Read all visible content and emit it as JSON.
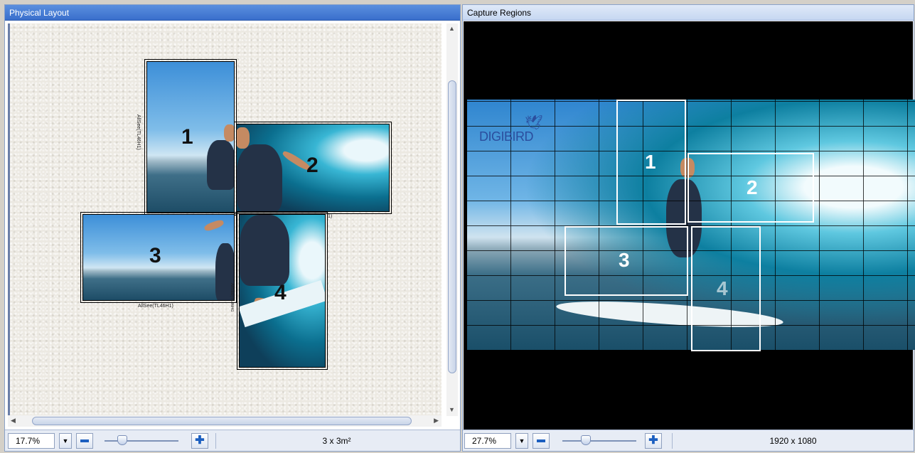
{
  "left_panel": {
    "title": "Physical Layout",
    "displays": [
      {
        "number": "1",
        "label": "AllSee(TL46H1)"
      },
      {
        "number": "2",
        "label": "1)"
      },
      {
        "number": "3",
        "label": "AllSee(TL46H1)"
      },
      {
        "number": "4",
        "label": "AllSee(TL46H1)"
      }
    ],
    "toolbar": {
      "zoom": "17.7%",
      "info": "3 x 3m²"
    }
  },
  "right_panel": {
    "title": "Capture Regions",
    "logo_text": "DIGIBIRD",
    "regions": [
      "1",
      "2",
      "3",
      "4"
    ],
    "toolbar": {
      "zoom": "27.7%",
      "resolution": "1920 x 1080"
    }
  },
  "icons": {
    "zoom_out": "minus-icon",
    "zoom_in": "plus-icon",
    "dropdown": "chevron-down-icon"
  },
  "colors": {
    "active_header": "#3a6fcc",
    "inactive_header": "#c6d7f1",
    "button_icon": "#1c5fc0"
  }
}
